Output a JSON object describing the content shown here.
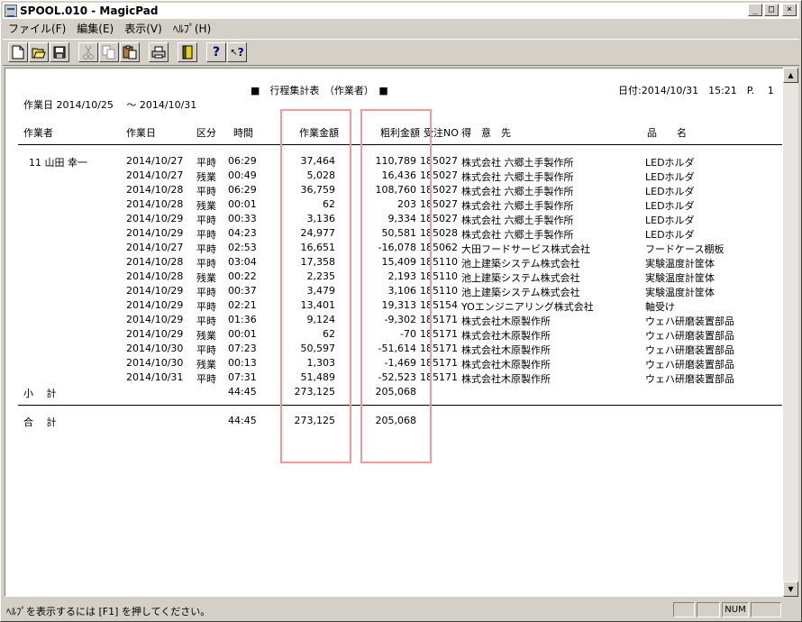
{
  "window": {
    "title": "SPOOL.010 - MagicPad",
    "min_label": "_",
    "max_label": "□",
    "close_label": "×"
  },
  "menu": [
    "ファイル(F)",
    "編集(E)",
    "表示(V)",
    "ﾍﾙﾌﾟ(H)"
  ],
  "toolbar_icons": [
    "new-icon",
    "open-icon",
    "save-icon",
    "cut-icon",
    "copy-icon",
    "paste-icon",
    "print-icon",
    "book-icon",
    "help-icon",
    "context-help-icon"
  ],
  "report": {
    "title": "■　行程集計表　（作業者）　■",
    "period_label": "作業日 2014/10/25　 〜 2014/10/31",
    "date_label": "日付:2014/10/31　15:21　P.　 1",
    "headers": {
      "worker": "作業者",
      "date": "作業日",
      "kubun": "区分",
      "time": "時間",
      "amount": "作業金額",
      "profit": "粗利金額",
      "order": "受注NO",
      "client": "得　意　先",
      "item": "品　　名"
    },
    "worker": "11 山田 幸一",
    "rows": [
      {
        "date": "2014/10/27",
        "kubun": "平時",
        "time": "06:29",
        "amount": "37,464",
        "profit": "110,789",
        "order": "185027",
        "client": "株式会社 六郷土手製作所",
        "item": "LEDホルダ"
      },
      {
        "date": "2014/10/27",
        "kubun": "残業",
        "time": "00:49",
        "amount": "5,028",
        "profit": "16,436",
        "order": "185027",
        "client": "株式会社 六郷土手製作所",
        "item": "LEDホルダ"
      },
      {
        "date": "2014/10/28",
        "kubun": "平時",
        "time": "06:29",
        "amount": "36,759",
        "profit": "108,760",
        "order": "185027",
        "client": "株式会社 六郷土手製作所",
        "item": "LEDホルダ"
      },
      {
        "date": "2014/10/28",
        "kubun": "残業",
        "time": "00:01",
        "amount": "62",
        "profit": "203",
        "order": "185027",
        "client": "株式会社 六郷土手製作所",
        "item": "LEDホルダ"
      },
      {
        "date": "2014/10/29",
        "kubun": "平時",
        "time": "00:33",
        "amount": "3,136",
        "profit": "9,334",
        "order": "185027",
        "client": "株式会社 六郷土手製作所",
        "item": "LEDホルダ"
      },
      {
        "date": "2014/10/29",
        "kubun": "平時",
        "time": "04:23",
        "amount": "24,977",
        "profit": "50,581",
        "order": "185028",
        "client": "株式会社 六郷土手製作所",
        "item": "LEDホルダ"
      },
      {
        "date": "2014/10/27",
        "kubun": "平時",
        "time": "02:53",
        "amount": "16,651",
        "profit": "-16,078",
        "order": "185062",
        "client": "大田フードサービス株式会社",
        "item": "フードケース棚板"
      },
      {
        "date": "2014/10/28",
        "kubun": "平時",
        "time": "03:04",
        "amount": "17,358",
        "profit": "15,409",
        "order": "185110",
        "client": "池上建築システム株式会社",
        "item": "実験温度計筐体"
      },
      {
        "date": "2014/10/28",
        "kubun": "残業",
        "time": "00:22",
        "amount": "2,235",
        "profit": "2,193",
        "order": "185110",
        "client": "池上建築システム株式会社",
        "item": "実験温度計筐体"
      },
      {
        "date": "2014/10/29",
        "kubun": "平時",
        "time": "00:37",
        "amount": "3,479",
        "profit": "3,106",
        "order": "185110",
        "client": "池上建築システム株式会社",
        "item": "実験温度計筐体"
      },
      {
        "date": "2014/10/29",
        "kubun": "平時",
        "time": "02:21",
        "amount": "13,401",
        "profit": "19,313",
        "order": "185154",
        "client": "YOエンジニアリング株式会社",
        "item": "軸受け"
      },
      {
        "date": "2014/10/29",
        "kubun": "平時",
        "time": "01:36",
        "amount": "9,124",
        "profit": "-9,302",
        "order": "185171",
        "client": "株式会社木原製作所",
        "item": "ウェハ研磨装置部品"
      },
      {
        "date": "2014/10/29",
        "kubun": "残業",
        "time": "00:01",
        "amount": "62",
        "profit": "-70",
        "order": "185171",
        "client": "株式会社木原製作所",
        "item": "ウェハ研磨装置部品"
      },
      {
        "date": "2014/10/30",
        "kubun": "平時",
        "time": "07:23",
        "amount": "50,597",
        "profit": "-51,614",
        "order": "185171",
        "client": "株式会社木原製作所",
        "item": "ウェハ研磨装置部品"
      },
      {
        "date": "2014/10/30",
        "kubun": "残業",
        "time": "00:13",
        "amount": "1,303",
        "profit": "-1,469",
        "order": "185171",
        "client": "株式会社木原製作所",
        "item": "ウェハ研磨装置部品"
      },
      {
        "date": "2014/10/31",
        "kubun": "平時",
        "time": "07:31",
        "amount": "51,489",
        "profit": "-52,523",
        "order": "185171",
        "client": "株式会社木原製作所",
        "item": "ウェハ研磨装置部品"
      }
    ],
    "subtotal": {
      "label": "小　 計",
      "time": "44:45",
      "amount": "273,125",
      "profit": "205,068"
    },
    "total": {
      "label": "合　 計",
      "time": "44:45",
      "amount": "273,125",
      "profit": "205,068"
    }
  },
  "status": {
    "text": "ﾍﾙﾌﾟを表示するには [F1] を押してください。",
    "num": "NUM"
  },
  "colors": {
    "highlight_box": "#f09a9a"
  }
}
